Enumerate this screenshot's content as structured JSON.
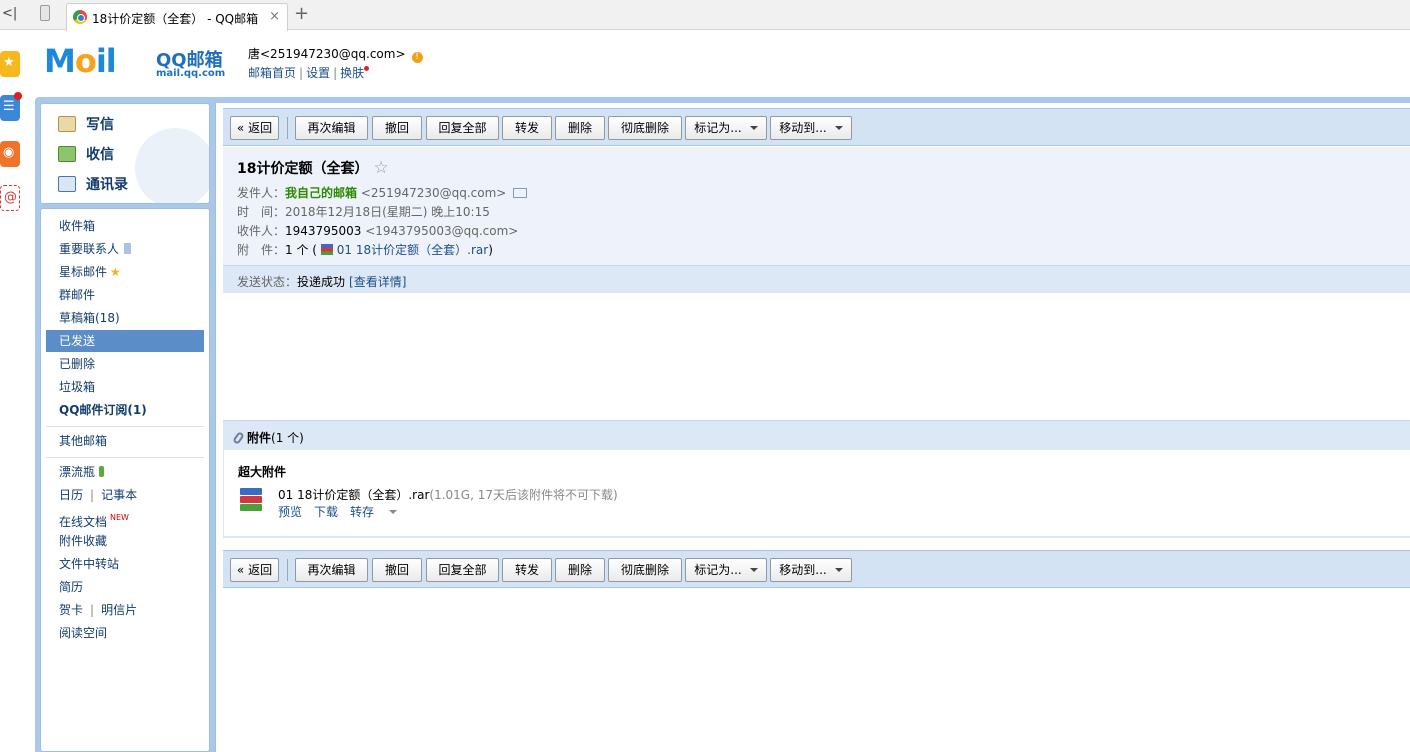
{
  "browser": {
    "back": "<|",
    "tab_title": "18计价定额（全套） - QQ邮箱",
    "close": "×",
    "new_tab": "+"
  },
  "header": {
    "logo_mail": "Mail",
    "logo_mail_left": "M",
    "logo_mail_o": "o",
    "logo_mail_right": "il",
    "logo_qq": "QQ邮箱",
    "logo_domain": "mail.qq.com",
    "user_line": "唐<251947230@qq.com>",
    "warn": "!",
    "link_home": "邮箱首页",
    "link_settings": "设置",
    "link_skin": "换肤",
    "link_sep": "|"
  },
  "quick_actions": {
    "compose": "写信",
    "receive": "收信",
    "contacts": "通讯录"
  },
  "sidebar": {
    "inbox": "收件箱",
    "vip": "重要联系人",
    "starred": "星标邮件",
    "group": "群邮件",
    "drafts": "草稿箱(18)",
    "sent": "已发送",
    "deleted": "已删除",
    "spam": "垃圾箱",
    "subscriptions": "QQ邮件订阅(1)",
    "other": "其他邮箱",
    "bottle": "漂流瓶",
    "calendar": "日历",
    "notes": "记事本",
    "docs": "在线文档",
    "docs_badge": "NEW",
    "favorites": "附件收藏",
    "transfer": "文件中转站",
    "resume": "简历",
    "cards": "贺卡",
    "postcards": "明信片",
    "reading": "阅读空间",
    "pipe": "|",
    "star": "★"
  },
  "toolbar": {
    "back": "« 返回",
    "reedit": "再次编辑",
    "recall": "撤回",
    "reply_all": "回复全部",
    "forward": "转发",
    "delete": "删除",
    "delete_forever": "彻底删除",
    "mark_as": "标记为...",
    "move_to": "移动到..."
  },
  "mail": {
    "subject": "18计价定额（全套）",
    "star": "☆",
    "from_label": "发件人：",
    "from_name": "我自己的邮箱",
    "from_addr": "<251947230@qq.com>",
    "time_label": "时　间：",
    "time_value": "2018年12月18日(星期二) 晚上10:15",
    "to_label": "收件人：",
    "to_name": "1943795003",
    "to_addr": "<1943795003@qq.com>",
    "att_label": "附　件：",
    "att_count": "1 个 (",
    "att_name": "01 18计价定额（全套）.rar",
    "att_close": ")",
    "status_label": "发送状态：",
    "status_value": "投递成功",
    "status_link": "[查看详情]"
  },
  "attachments": {
    "header_label": "附件",
    "header_count": "(1 个)",
    "big_label": "超大附件",
    "file_name": "01 18计价定额（全套）.rar",
    "file_info": "(1.01G, 17天后该附件将不可下载)",
    "preview": "预览",
    "download": "下载",
    "save": "转存"
  }
}
